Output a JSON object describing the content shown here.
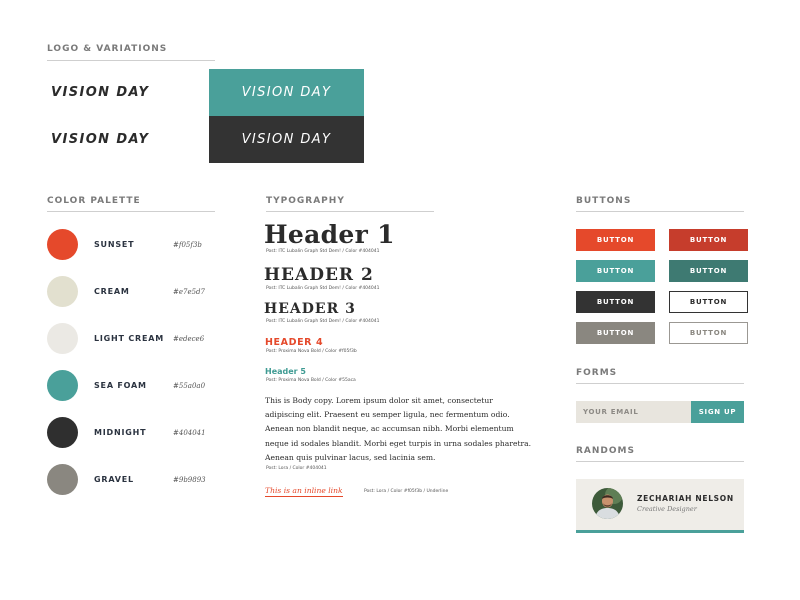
{
  "sections": {
    "logo": "LOGO & VARIATIONS",
    "palette": "COLOR PALETTE",
    "typography": "TYPOGRAPHY",
    "buttons": "BUTTONS",
    "forms": "FORMS",
    "randoms": "RANDOMS"
  },
  "logo": {
    "text": "VISION DAY",
    "variants": [
      {
        "bg": "#ffffff",
        "fg": "#2b2b2b"
      },
      {
        "bg": "#4aa09a",
        "fg": "#ffffff"
      },
      {
        "bg": "#ffffff",
        "fg": "#2b2b2b"
      },
      {
        "bg": "#333333",
        "fg": "#ffffff"
      }
    ]
  },
  "palette": [
    {
      "name": "SUNSET",
      "hex": "#f05f3b",
      "color": "#e5492b"
    },
    {
      "name": "CREAM",
      "hex": "#e7e5d7",
      "color": "#e2e0cf"
    },
    {
      "name": "LIGHT CREAM",
      "hex": "#edece6",
      "color": "#ebe9e4"
    },
    {
      "name": "SEA FOAM",
      "hex": "#55a0a0",
      "color": "#4aa09a"
    },
    {
      "name": "MIDNIGHT",
      "hex": "#404041",
      "color": "#2f2f2f"
    },
    {
      "name": "GRAVEL",
      "hex": "#9b9893",
      "color": "#8a8780"
    }
  ],
  "typography": {
    "h1": "Header 1",
    "h1_spec": "Post: ITC Lubalin Graph Std Dem! / Color #404041",
    "h2": "HEADER 2",
    "h2_spec": "Post: ITC Lubalin Graph Std Dem! / Color #404041",
    "h3": "HEADER 3",
    "h3_spec": "Post: ITC Lubalin Graph Std Dem! / Color #404041",
    "h4": "HEADER 4",
    "h4_spec": "Post: Proxima Nova Bold / Color #f05f3b",
    "h5": "Header 5",
    "h5_spec": "Post: Proxima Nova Bold / Color #55aca",
    "body": "This is Body copy. Lorem ipsum dolor sit amet, consectetur adipiscing elit. Praesent eu semper ligula, nec fermentum odio. Aenean non blandit neque, ac accumsan nibh. Morbi elementum neque id sodales blandit. Morbi eget turpis in urna sodales pharetra. Aenean quis pulvinar lacus, sed lacinia sem.",
    "body_spec": "Post: Lora / Color #404041",
    "link": "This is an inline link",
    "link_spec": "Post: Lora / Color #f05f3b / Underline"
  },
  "buttons": {
    "label": "BUTTON",
    "styles": [
      {
        "bg": "#e5492b",
        "fg": "#ffffff",
        "border": "#e5492b"
      },
      {
        "bg": "#c63d2c",
        "fg": "#ffffff",
        "border": "#c63d2c"
      },
      {
        "bg": "#4aa09a",
        "fg": "#ffffff",
        "border": "#4aa09a"
      },
      {
        "bg": "#3e7a72",
        "fg": "#ffffff",
        "border": "#3e7a72"
      },
      {
        "bg": "#333333",
        "fg": "#ffffff",
        "border": "#333333"
      },
      {
        "bg": "#ffffff",
        "fg": "#2b2b2b",
        "border": "#333333"
      },
      {
        "bg": "#8a8780",
        "fg": "#ffffff",
        "border": "#8a8780"
      },
      {
        "bg": "#ffffff",
        "fg": "#8a8780",
        "border": "#9b9893"
      }
    ]
  },
  "forms": {
    "email_placeholder": "YOUR EMAIL",
    "signup_label": "SIGN UP"
  },
  "randoms": {
    "name": "ZECHARIAH NELSON",
    "role": "Creative Designer"
  }
}
